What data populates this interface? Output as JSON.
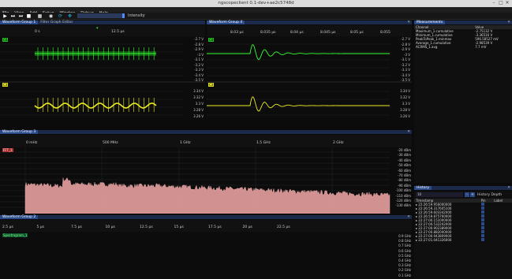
{
  "window": {
    "title": "ngscopeclient 0.1-dev+ae2c5748d"
  },
  "menu": [
    "File",
    "View",
    "Add",
    "Setup",
    "Window",
    "Debug",
    "Help"
  ],
  "toolbar": {
    "intensity_label": "Intensity"
  },
  "wg1": {
    "tab1": "Waveform Group 1",
    "tab2": "Filter Graph Editor",
    "time_ticks": [
      "0 s",
      "12.5 µs"
    ],
    "ch1_label": "C4",
    "ch2_label": "C3",
    "ch1_axis": [
      "-2.7 V",
      "-2.8 V",
      "-2.9 V",
      "-3 V",
      "-3.1 V",
      "-3.2 V",
      "-3.3 V",
      "-3.4 V",
      "-3.5 V"
    ],
    "ch2_axis": [
      "3.34 V",
      "3.32 V",
      "3.3 V",
      "3.28 V",
      "3.26 V"
    ]
  },
  "wg4": {
    "tab": "Waveform Group 4",
    "time_ticks": [
      "8.03 µs",
      "8.035 µs",
      "8.04 µs",
      "8.045 µs",
      "8.05 µs",
      "8.055"
    ],
    "ch1_label": "C4",
    "ch2_label": "C3",
    "ch1_axis": [
      "-2.7 V",
      "-2.8 V",
      "-2.9 V",
      "-3 V",
      "-3.1 V",
      "-3.2 V",
      "-3.3 V",
      "-3.4 V",
      "-3.5 V"
    ],
    "ch2_axis": [
      "3.34 V",
      "3.32 V",
      "3.3 V",
      "3.28 V",
      "3.26 V"
    ]
  },
  "measurements": {
    "title": "Measurements",
    "headers": [
      "Channel",
      "Value"
    ],
    "rows": [
      [
        "Maximum_1.cumulative",
        "-2.75132 V"
      ],
      [
        "Minimum_1.cumulative",
        "-3.36516 V"
      ],
      [
        "PeakToPeak_1.minmax",
        "596.58527 mV"
      ],
      [
        "Average_1.cumulative",
        "-2.98539 V"
      ],
      [
        "ACRMS_1.avg",
        "7.7 mV"
      ]
    ]
  },
  "wg3": {
    "tab": "Waveform Group 3",
    "freq_ticks": [
      "0 mHz",
      "500 MHz",
      "1 GHz",
      "1.5 GHz",
      "2 GHz"
    ],
    "label": "FFT_1",
    "axis": [
      "-20 dBm",
      "-30 dBm",
      "-40 dBm",
      "-50 dBm",
      "-60 dBm",
      "-70 dBm",
      "-80 dBm",
      "-90 dBm",
      "-100 dBm",
      "-110 dBm",
      "-120 dBm",
      "-130 dBm"
    ]
  },
  "wg2": {
    "tab": "Waveform Group 2",
    "time_ticks": [
      "2.5 µs",
      "5 µs",
      "7.5 µs",
      "10 µs",
      "12.5 µs",
      "15 µs",
      "17.5 µs",
      "20 µs",
      "22.5 µs"
    ],
    "label": "Spectrogram_1",
    "axis": [
      "0.9 GHz",
      "0.8 GHz",
      "0.7 GHz",
      "0.6 GHz",
      "0.5 GHz",
      "0.4 GHz",
      "0.3 GHz",
      "0.2 GHz",
      "0.1 GHz"
    ]
  },
  "history": {
    "title": "History",
    "depth_label": "History Depth",
    "depth_value": "10",
    "headers": [
      "Timestamp",
      "Pin",
      "Label"
    ],
    "rows": [
      "22:26:59.956000000",
      "22:26:59.317605100",
      "22:26:59.603342000",
      "22:26:59.875760000",
      "22:27:00.151000000",
      "22:27:00.532202000",
      "22:27:00.902389000",
      "22:27:00.882000000",
      "22:27:00.943809000",
      "22:27:01.041326000"
    ]
  }
}
